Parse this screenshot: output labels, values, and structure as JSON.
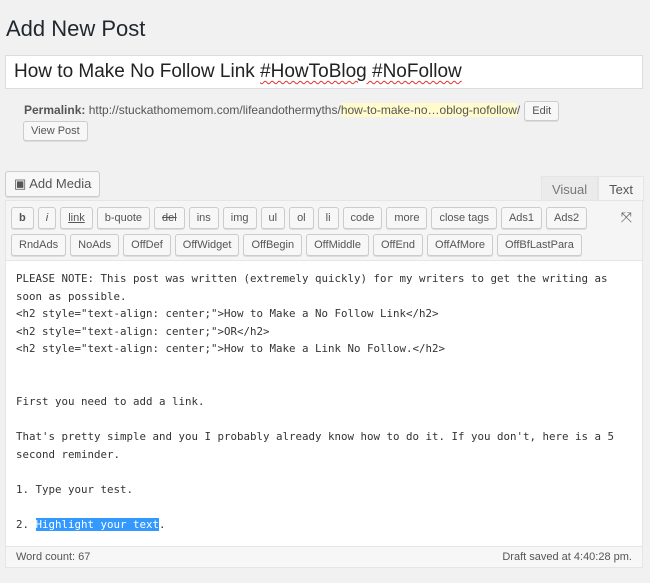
{
  "page_title": "Add New Post",
  "post_title": "How to Make No Follow Link ",
  "post_title_tags": "#HowToBlog #NoFollow",
  "permalink": {
    "label": "Permalink:",
    "base": "http://stuckathomemom.com/lifeandothermyths/",
    "slug": "how-to-make-no…oblog-nofollow",
    "trail": "/",
    "edit": "Edit"
  },
  "view_post": "View Post",
  "add_media": "Add Media",
  "tabs": [
    "Visual",
    "Text"
  ],
  "toolbar_row1": [
    "b",
    "i",
    "link",
    "b-quote",
    "del",
    "ins",
    "img",
    "ul",
    "ol",
    "li",
    "code",
    "more",
    "close tags",
    "Ads1",
    "Ads2"
  ],
  "toolbar_row2": [
    "RndAds",
    "NoAds",
    "OffDef",
    "OffWidget",
    "OffBegin",
    "OffMiddle",
    "OffEnd",
    "OffAfMore",
    "OffBfLastPara"
  ],
  "content_before": "PLEASE NOTE: This post was written (extremely quickly) for my writers to get the writing as soon as possible.\n<h2 style=\"text-align: center;\">How to Make a No Follow Link</h2>\n<h2 style=\"text-align: center;\">OR</h2>\n<h2 style=\"text-align: center;\">How to Make a Link No Follow.</h2>\n\n\nFirst you need to add a link.\n\nThat's pretty simple and you I probably already know how to do it. If you don't, here is a 5 second reminder.\n\n1. Type your test.\n\n2. ",
  "content_selected": "Highlight your text",
  "content_after": ".",
  "word_count": "Word count: 67",
  "draft_status": "Draft saved at 4:40:28 pm."
}
